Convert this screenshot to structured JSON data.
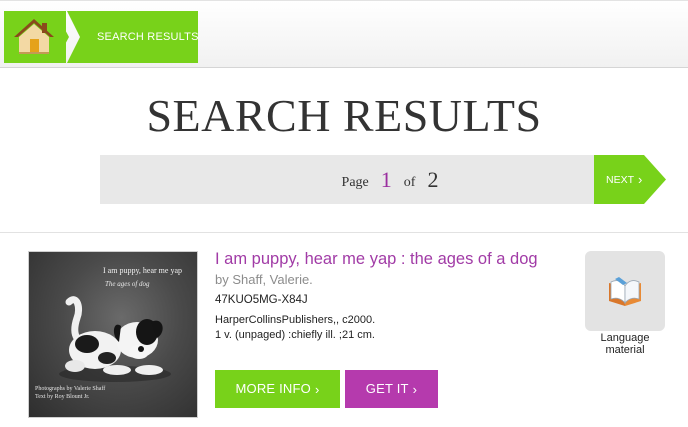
{
  "breadcrumb": {
    "home_icon": "home-icon",
    "current": "SEARCH RESULTS"
  },
  "heading": "SEARCH RESULTS",
  "pager": {
    "page_label": "Page",
    "current_page": "1",
    "of_label": "of",
    "total_pages": "2",
    "next_label": "NEXT",
    "chevron": "›"
  },
  "results": [
    {
      "cover": {
        "title": "I am puppy, hear me yap",
        "subtitle": "The ages of dog",
        "credit_line1": "Photographs by Valerie Shaff",
        "credit_line2": "Text by Roy Blount Jr."
      },
      "title": "I am puppy, hear me yap : the ages of a dog",
      "author": "by Shaff, Valerie.",
      "record_id": "47KUO5MG-X84J",
      "publisher": "HarperCollinsPublishers,, c2000.",
      "physical": "1 v. (unpaged) :chiefly ill. ;21 cm.",
      "format_icon": "book-icon",
      "format_line1": "Language",
      "format_line2": "material",
      "more_info_label": "MORE INFO",
      "get_it_label": "GET IT",
      "chevron": "›"
    }
  ],
  "colors": {
    "brand_green": "#78d21a",
    "brand_purple": "#b53aad",
    "link_purple": "#a13ba6"
  }
}
